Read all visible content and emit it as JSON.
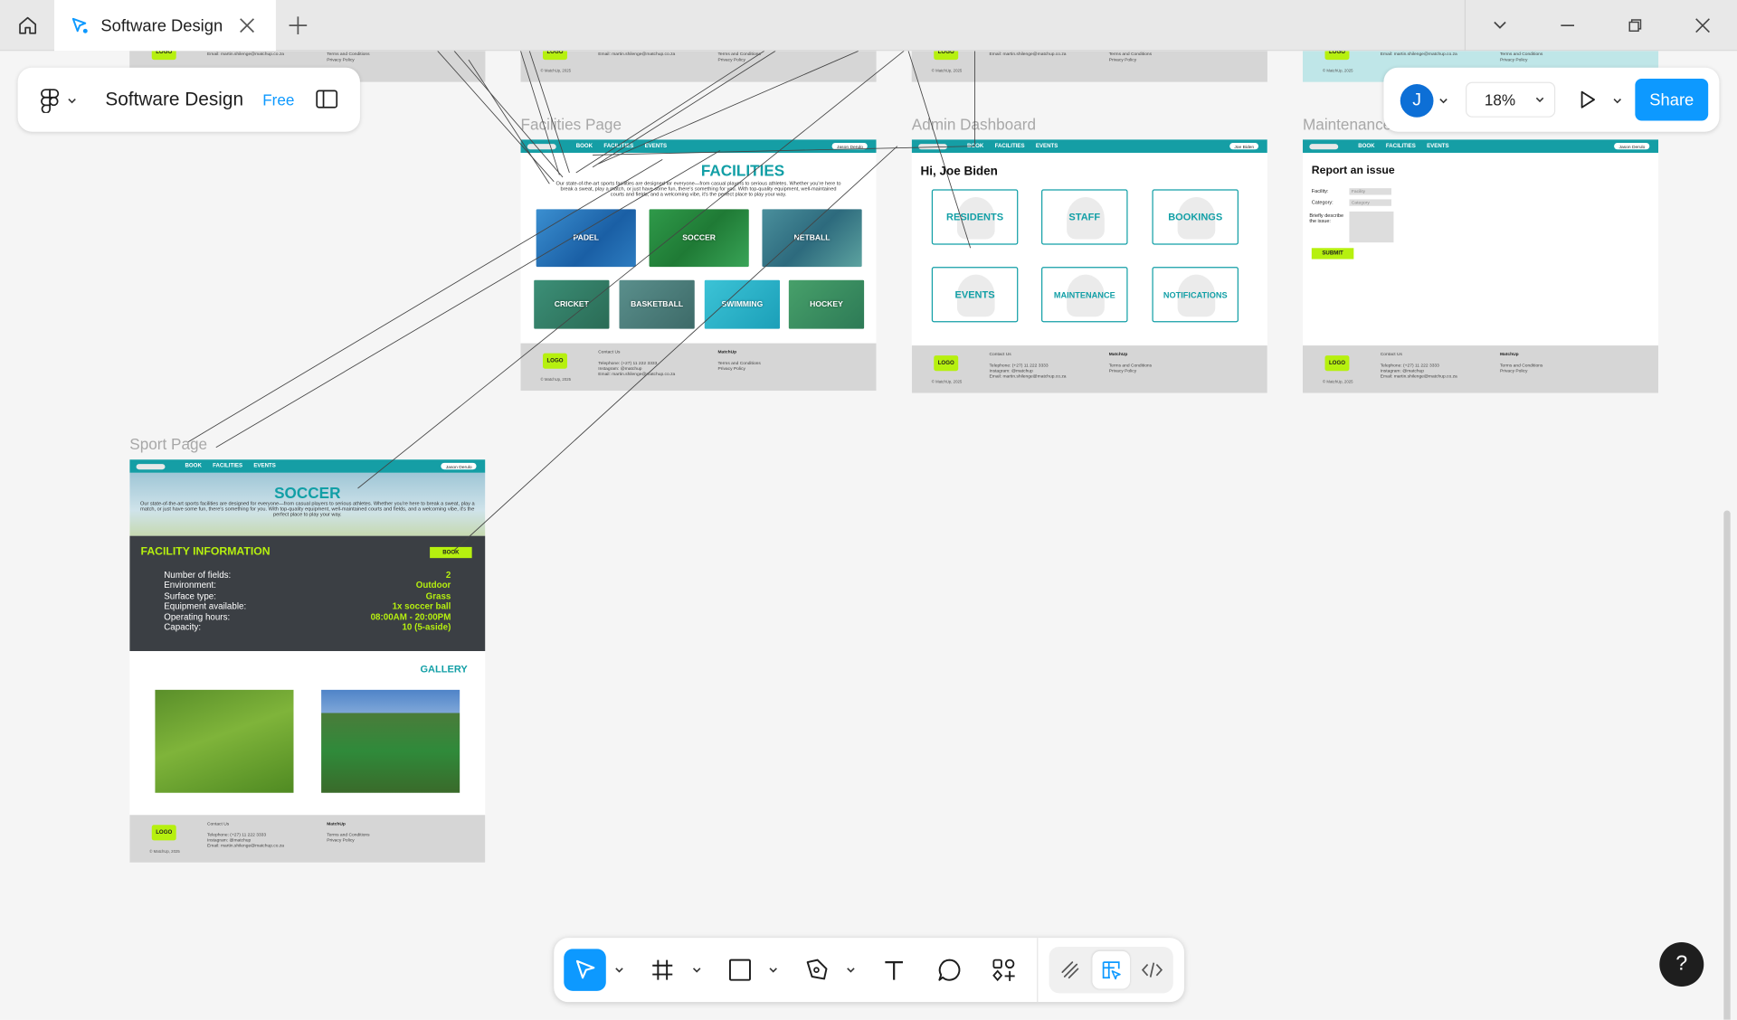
{
  "tab": {
    "title": "Software Design"
  },
  "file_panel": {
    "title": "Software Design",
    "plan_badge": "Free"
  },
  "right_panel": {
    "avatar_initial": "J",
    "zoom": "18%",
    "share_label": "Share"
  },
  "frames": {
    "facilities": {
      "label": "Facilities Page",
      "heading": "FACILITIES",
      "intro": "Our state-of-the-art sports facilities are designed for everyone—from casual players to serious athletes. Whether you're here to break a sweat, play a match, or just have some fun, there's something for you. With top-quality equipment, well-maintained courts and fields, and a welcoming vibe, it's the perfect place to play your way.",
      "tiles": [
        "PADEL",
        "SOCCER",
        "NETBALL",
        "CRICKET",
        "BASKETBALL",
        "SWIMMING",
        "HOCKEY"
      ]
    },
    "admin": {
      "label": "Admin Dashboard",
      "greeting": "Hi, Joe Biden",
      "user": "Joe Biden",
      "cards": [
        "RESIDENTS",
        "STAFF",
        "BOOKINGS",
        "EVENTS",
        "MAINTENANCE",
        "NOTIFICATIONS"
      ]
    },
    "maintenance": {
      "label": "Maintenance",
      "heading": "Report an issue",
      "facility_label": "Facility:",
      "facility_placeholder": "Facility",
      "category_label": "Category:",
      "category_placeholder": "Category",
      "describe_label": "Briefly describe the issue:",
      "submit": "SUBMIT"
    },
    "sport": {
      "label": "Sport Page",
      "heading": "SOCCER",
      "intro": "Our state-of-the-art sports facilities are designed for everyone—from casual players to serious athletes. Whether you're here to break a sweat, play a match, or just have some fun, there's something for you. With top-quality equipment, well-maintained courts and fields, and a welcoming vibe, it's the perfect place to play your way.",
      "info_title": "FACILITY INFORMATION",
      "book": "BOOK",
      "info": [
        {
          "k": "Number of fields:",
          "v": "2"
        },
        {
          "k": "Environment:",
          "v": "Outdoor"
        },
        {
          "k": "Surface type:",
          "v": "Grass"
        },
        {
          "k": "Equipment available:",
          "v": "1x soccer ball"
        },
        {
          "k": "Operating hours:",
          "v": "08:00AM - 20:00PM"
        },
        {
          "k": "Capacity:",
          "v": "10 (5-aside)"
        }
      ],
      "gallery": "GALLERY",
      "user": "Jason Derulo"
    }
  },
  "nav": {
    "book": "BOOK",
    "facilities": "FACILITIES",
    "events": "EVENTS",
    "user": "Jason Derulo"
  },
  "footer": {
    "logo": "LOGO",
    "copyright": "© MatchUp, 2025",
    "contact_title": "Contact Us",
    "telephone": "Telephone: (+27) 11 222 3333",
    "instagram": "Instagram: @matchup",
    "email": "Email: martin.shilenge@matchup.co.za",
    "brand": "MatchUp",
    "terms": "Terms and Conditions",
    "privacy": "Privacy Policy"
  },
  "help": "?",
  "colors": {
    "teal": "#129fa6",
    "lime": "#b6f00f",
    "share": "#0d99ff",
    "dark_panel": "#3b3f44"
  }
}
